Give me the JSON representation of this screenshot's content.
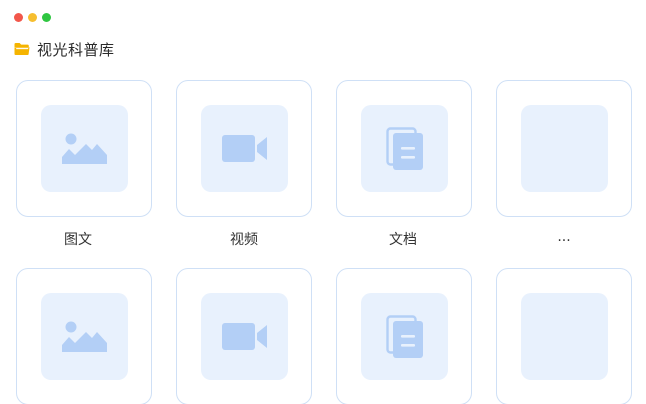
{
  "window": {
    "title": "视光科普库"
  },
  "colors": {
    "folder": "#f5b400",
    "tile_border": "#cfe0f6",
    "icon_bg": "#e8f1fd",
    "icon": "#b3cff6"
  },
  "rows": [
    {
      "items": [
        {
          "label": "图文",
          "icon": "image-icon"
        },
        {
          "label": "视频",
          "icon": "video-icon"
        },
        {
          "label": "文档",
          "icon": "document-icon"
        },
        {
          "label": "...",
          "icon": "blank"
        }
      ]
    },
    {
      "items": [
        {
          "label": "",
          "icon": "image-icon"
        },
        {
          "label": "",
          "icon": "video-icon"
        },
        {
          "label": "",
          "icon": "document-icon"
        },
        {
          "label": "",
          "icon": "blank"
        }
      ]
    }
  ]
}
